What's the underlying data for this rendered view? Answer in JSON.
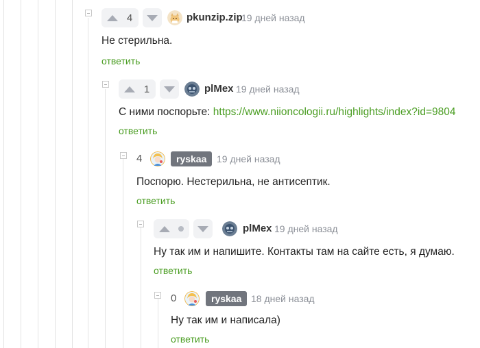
{
  "comments": [
    {
      "score": "4",
      "username": "pkunzip.zip",
      "time": "19 дней назад",
      "text": "Не стерильна.",
      "reply": "ответить",
      "avatar_icon": "cat-avatar-icon"
    },
    {
      "score": "1",
      "username": "plMex",
      "time": "19 дней назад",
      "text_prefix": "С ними поспорьте: ",
      "link": "https://www.niioncologii.ru/highlights/index?id=9804",
      "reply": "ответить",
      "avatar_icon": "blue-avatar-icon"
    },
    {
      "score": "4",
      "username": "ryskaa",
      "time": "19 дней назад",
      "text": "Поспорю. Нестерильна, не антисептик.",
      "reply": "ответить",
      "avatar_icon": "girl-avatar-icon"
    },
    {
      "score": "",
      "username": "plMex",
      "time": "19 дней назад",
      "text": "Ну так им и напишите. Контакты там на сайте есть, я думаю.",
      "reply": "ответить",
      "avatar_icon": "blue-avatar-icon"
    },
    {
      "score": "0",
      "username": "ryskaa",
      "time": "18 дней назад",
      "text": "Ну так им и написала)",
      "reply": "ответить",
      "avatar_icon": "girl-avatar-icon"
    }
  ],
  "colors": {
    "link": "#4a9d22",
    "badge": "#71757d",
    "thread_line": "#e3e3e3",
    "vote_bg": "#f1f2f4"
  }
}
